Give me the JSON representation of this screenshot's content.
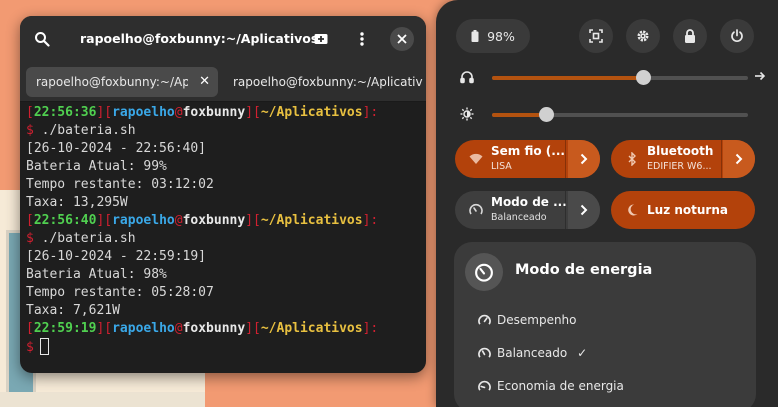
{
  "terminal": {
    "title": "rapoelho@foxbunny:~/Aplicativos",
    "tabs": [
      {
        "label": "rapoelho@foxbunny:~/Aplicativos",
        "active": true
      },
      {
        "label": "rapoelho@foxbunny:~/Aplicativos",
        "active": false
      }
    ],
    "prompt": {
      "user": "rapoelho",
      "at": "@",
      "host": "foxbunny",
      "path": "~/Aplicativos",
      "symbol": "$"
    },
    "blocks": [
      {
        "time": "22:56:36",
        "command": "./bateria.sh",
        "output": [
          "[26-10-2024 - 22:56:40]",
          "Bateria Atual: 99%",
          "Tempo restante: 03:12:02",
          "Taxa: 13,295W"
        ]
      },
      {
        "time": "22:56:40",
        "command": "./bateria.sh",
        "output": [
          "[26-10-2024 - 22:59:19]",
          "Bateria Atual: 98%",
          "Tempo restante: 05:28:07",
          "Taxa: 7,621W"
        ]
      }
    ],
    "last_prompt_time": "22:59:19"
  },
  "panel": {
    "battery_label": "98%",
    "volume_level": 0.59,
    "brightness_level": 0.21,
    "tiles": {
      "wifi": {
        "title": "Sem fio (...",
        "subtitle": "LISA"
      },
      "bluetooth": {
        "title": "Bluetooth",
        "subtitle": "EDIFIER W6..."
      },
      "power": {
        "title": "Modo de ...",
        "subtitle": "Balanceado"
      },
      "night": {
        "title": "Luz noturna"
      }
    },
    "power_menu": {
      "title": "Modo de energia",
      "items": [
        {
          "label": "Desempenho",
          "selected": false
        },
        {
          "label": "Balanceado",
          "selected": true
        },
        {
          "label": "Economia de energia",
          "selected": false
        }
      ]
    }
  },
  "colors": {
    "accent": "#b3420b",
    "terminal_bg": "#1e1e1e",
    "prompt_red": "#d02030",
    "prompt_green": "#50d050",
    "prompt_cyan": "#3aa8e8",
    "prompt_yellow": "#e8c040"
  }
}
